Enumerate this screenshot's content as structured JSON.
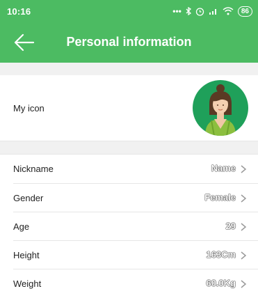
{
  "status_bar": {
    "time": "10:16",
    "icons": [
      "more-dots-icon",
      "bluetooth-icon",
      "alarm-icon",
      "signal-icon",
      "wifi-icon"
    ],
    "battery": "86"
  },
  "header": {
    "title": "Personal information",
    "back_icon": "back-arrow-icon"
  },
  "profile": {
    "icon_label": "My icon",
    "avatar": "female-avatar"
  },
  "fields": [
    {
      "label": "Nickname",
      "value": "Name"
    },
    {
      "label": "Gender",
      "value": "Female"
    },
    {
      "label": "Age",
      "value": "29"
    },
    {
      "label": "Height",
      "value": "163Cm"
    },
    {
      "label": "Weight",
      "value": "60.0Kg"
    }
  ],
  "colors": {
    "primary": "#4cbb62",
    "avatar_bg": "#1fa05a",
    "section_gap": "#f1f1f1"
  }
}
